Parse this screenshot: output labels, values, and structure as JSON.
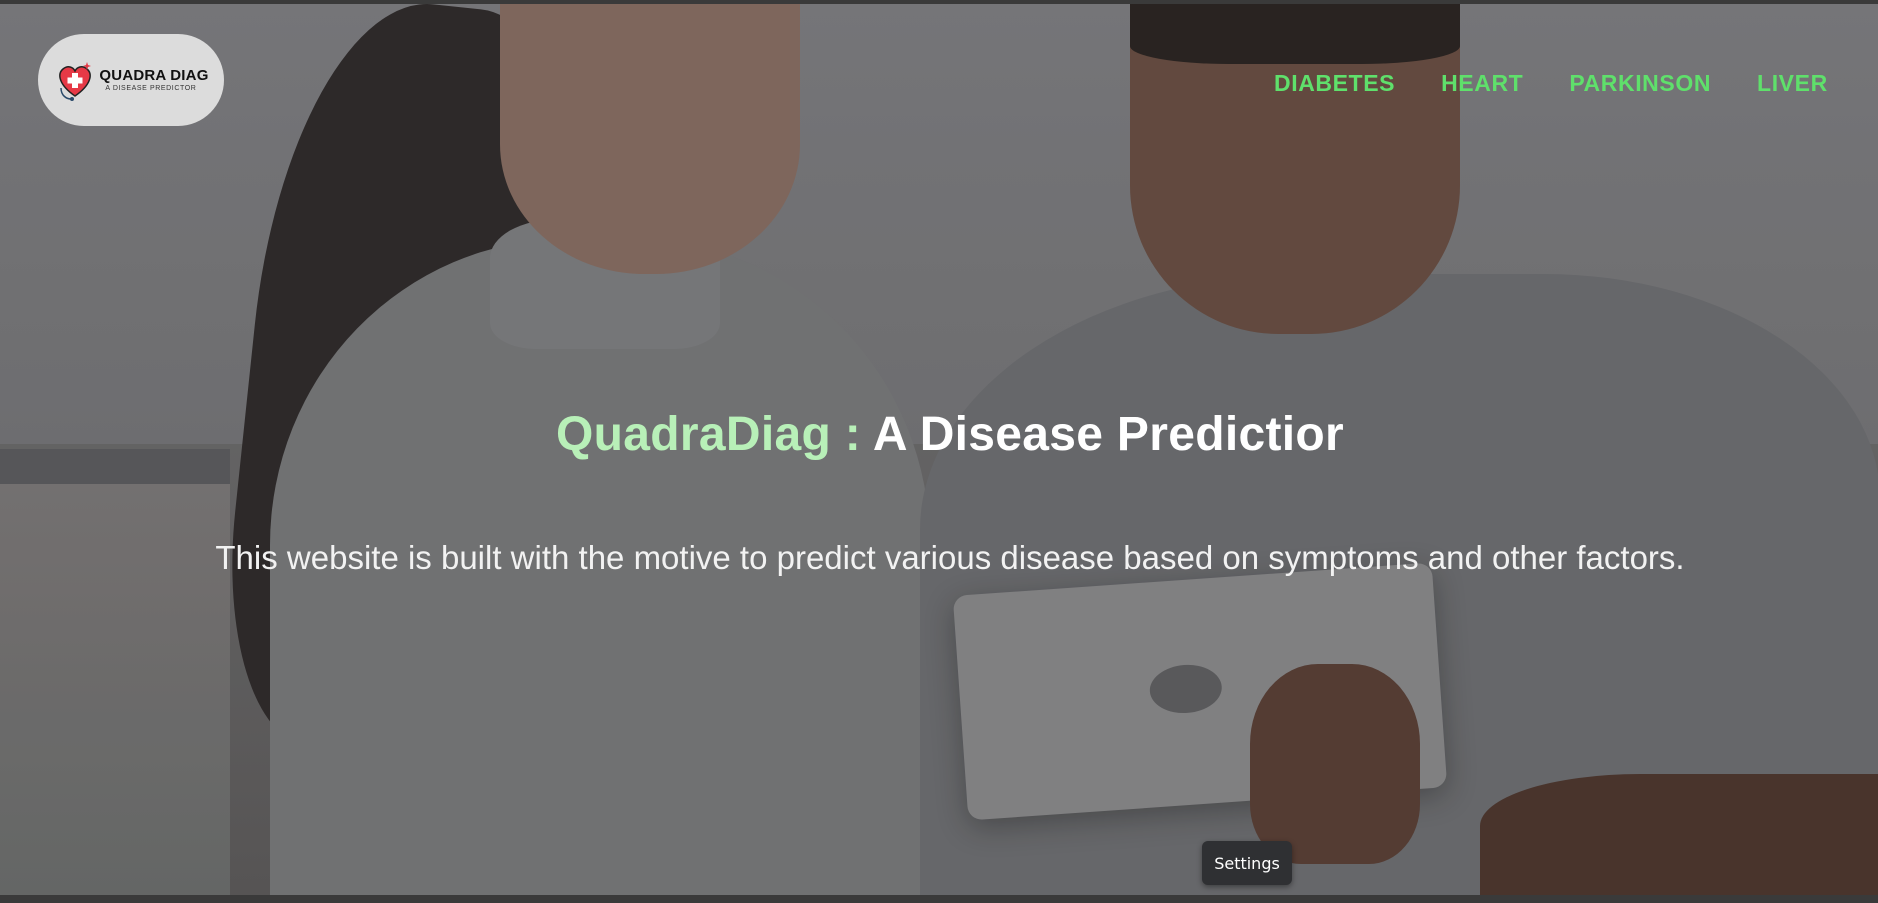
{
  "logo": {
    "title": "QUADRA DIAG",
    "subtitle": "A DISEASE PREDICTOR"
  },
  "nav": {
    "items": [
      {
        "label": "DIABETES"
      },
      {
        "label": "HEART"
      },
      {
        "label": "PARKINSON"
      },
      {
        "label": "LIVER"
      }
    ]
  },
  "hero": {
    "brand": "QuadraDiag :",
    "headline_rest": "A Disease Predictior",
    "tagline": "This website is built with the motive to predict various disease based on symptoms and other factors."
  },
  "settings": {
    "label": "Settings"
  },
  "colors": {
    "nav_accent": "#5fe06b",
    "brand_accent": "#b8f0b8",
    "logo_heart": "#e63946"
  },
  "icons": {
    "logo": "heart-cross-stethoscope-icon"
  }
}
